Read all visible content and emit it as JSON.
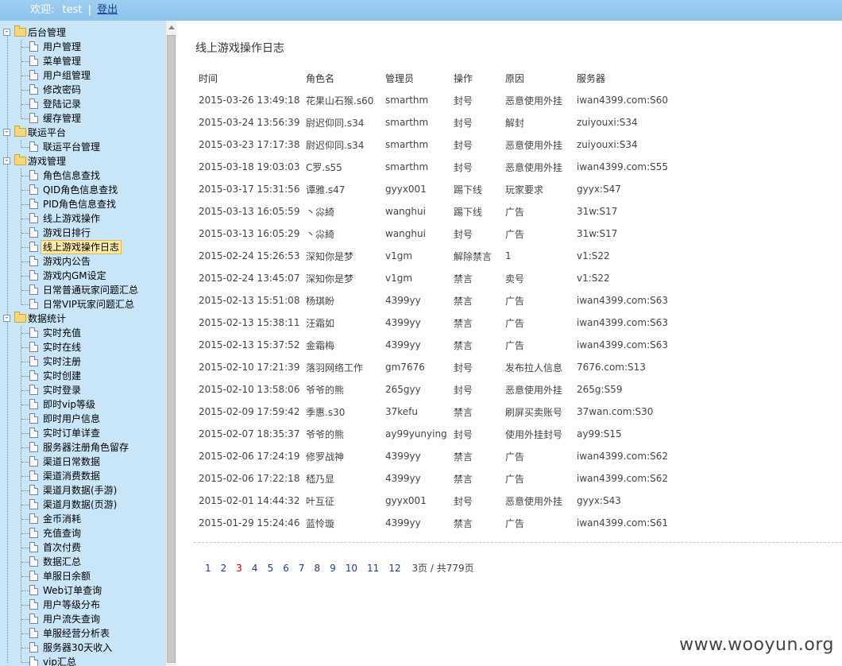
{
  "topbar": {
    "welcome_label": "欢迎:",
    "username": "test",
    "separator": "|",
    "logout_label": "登出"
  },
  "sidebar": {
    "groups": [
      {
        "label": "后台管理",
        "toggle": "-",
        "items": [
          "用户管理",
          "菜单管理",
          "用户组管理",
          "修改密码",
          "登陆记录",
          "缓存管理"
        ]
      },
      {
        "label": "联运平台",
        "toggle": "-",
        "items": [
          "联运平台管理"
        ]
      },
      {
        "label": "游戏管理",
        "toggle": "-",
        "items": [
          "角色信息查找",
          "QID角色信息查找",
          "PID角色信息查找",
          "线上游戏操作",
          "游戏日排行",
          "线上游戏操作日志",
          "游戏内公告",
          "游戏内GM设定",
          "日常普通玩家问题汇总",
          "日常VIP玩家问题汇总"
        ]
      },
      {
        "label": "数据统计",
        "toggle": "-",
        "items": [
          "实时充值",
          "实时在线",
          "实时注册",
          "实时创建",
          "实时登录",
          "即时vip等级",
          "即时用户信息",
          "实时订单详查",
          "服务器注册角色留存",
          "渠道日常数据",
          "渠道消费数据",
          "渠道月数据(手游)",
          "渠道月数据(页游)",
          "金币消耗",
          "充值查询",
          "首次付费",
          "数据汇总",
          "单服日余额",
          "Web订单查询",
          "用户等级分布",
          "用户流失查询",
          "单服经营分析表",
          "服务器30天收入",
          "vip汇总"
        ]
      }
    ],
    "selected_item": "线上游戏操作日志"
  },
  "main": {
    "title": "线上游戏操作日志",
    "table": {
      "headers": [
        "时间",
        "角色名",
        "管理员",
        "操作",
        "原因",
        "服务器"
      ],
      "rows": [
        [
          "2015-03-26 13:49:18",
          "花果山石猴.s60",
          "smarthm",
          "封号",
          "恶意使用外挂",
          "iwan4399.com:S60"
        ],
        [
          "2015-03-24 13:56:39",
          "尉迟仰同.s34",
          "smarthm",
          "封号",
          "解封",
          "zuiyouxi:S34"
        ],
        [
          "2015-03-23 17:17:38",
          "尉迟仰同.s34",
          "smarthm",
          "封号",
          "恶意使用外挂",
          "zuiyouxi:S34"
        ],
        [
          "2015-03-18 19:03:03",
          "C罗.s55",
          "smarthm",
          "封号",
          "恶意使用外挂",
          "iwan4399.com:S55"
        ],
        [
          "2015-03-17 15:31:56",
          "谭雅.s47",
          "gyyx001",
          "踢下线",
          "玩家要求",
          "gyyx:S47"
        ],
        [
          "2015-03-13 16:05:59",
          "丶尛綺",
          "wanghui",
          "踢下线",
          "广告",
          "31w:S17"
        ],
        [
          "2015-03-13 16:05:29",
          "丶尛綺",
          "wanghui",
          "封号",
          "广告",
          "31w:S17"
        ],
        [
          "2015-02-24 15:26:53",
          "深知你是梦",
          "v1gm",
          "解除禁言",
          "1",
          "v1:S22"
        ],
        [
          "2015-02-24 13:45:07",
          "深知你是梦",
          "v1gm",
          "禁言",
          "卖号",
          "v1:S22"
        ],
        [
          "2015-02-13 15:51:08",
          "杨琪盼",
          "4399yy",
          "禁言",
          "广告",
          "iwan4399.com:S63"
        ],
        [
          "2015-02-13 15:38:11",
          "汪霜如",
          "4399yy",
          "禁言",
          "广告",
          "iwan4399.com:S63"
        ],
        [
          "2015-02-13 15:37:52",
          "金霜梅",
          "4399yy",
          "禁言",
          "广告",
          "iwan4399.com:S63"
        ],
        [
          "2015-02-10 17:21:39",
          "落羽网络工作",
          "gm7676",
          "封号",
          "发布拉人信息",
          "7676.com:S13"
        ],
        [
          "2015-02-10 13:58:06",
          "爷爷的熊",
          "265gyy",
          "封号",
          "恶意使用外挂",
          "265g:S59"
        ],
        [
          "2015-02-09 17:59:42",
          "季惠.s30",
          "37kefu",
          "禁言",
          "刷屏买卖账号",
          "37wan.com:S30"
        ],
        [
          "2015-02-07 18:35:37",
          "爷爷的熊",
          "ay99yunying",
          "封号",
          "使用外挂封号",
          "ay99:S15"
        ],
        [
          "2015-02-06 17:24:19",
          "修罗战神",
          "4399yy",
          "禁言",
          "广告",
          "iwan4399.com:S62"
        ],
        [
          "2015-02-06 17:22:18",
          "嵇乃显",
          "4399yy",
          "禁言",
          "广告",
          "iwan4399.com:S62"
        ],
        [
          "2015-02-01 14:44:32",
          "叶互征",
          "gyyx001",
          "封号",
          "恶意使用外挂",
          "gyyx:S43"
        ],
        [
          "2015-01-29 15:24:46",
          "蓝怜璇",
          "4399yy",
          "禁言",
          "广告",
          "iwan4399.com:S61"
        ]
      ]
    },
    "pagination": {
      "pages": [
        "1",
        "2",
        "3",
        "4",
        "5",
        "6",
        "7",
        "8",
        "9",
        "10",
        "11",
        "12"
      ],
      "current": "3",
      "summary": "3页 / 共779页"
    }
  },
  "watermark": "www.wooyun.org"
}
